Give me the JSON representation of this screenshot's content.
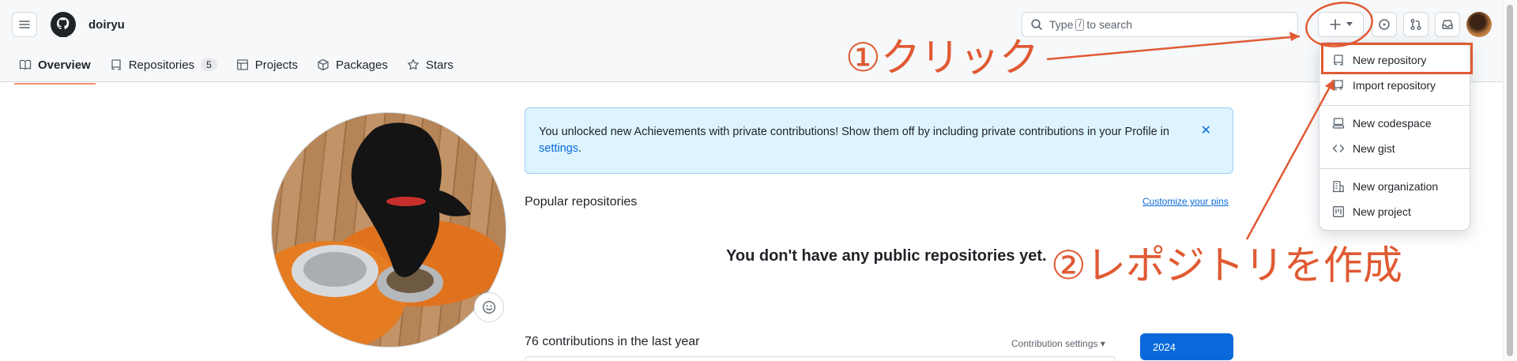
{
  "header": {
    "owner": "doiryu",
    "search": {
      "prefix": "Type",
      "key": "/",
      "suffix": "to search"
    },
    "icons": [
      "hamburger-icon",
      "github-logo-icon",
      "search-icon",
      "plus-icon",
      "caret-down-icon",
      "issue-icon",
      "pull-request-icon",
      "inbox-icon"
    ]
  },
  "tabs": [
    {
      "label": "Overview",
      "icon": "book-icon"
    },
    {
      "label": "Repositories",
      "icon": "repo-icon",
      "count": "5"
    },
    {
      "label": "Projects",
      "icon": "table-icon"
    },
    {
      "label": "Packages",
      "icon": "package-icon"
    },
    {
      "label": "Stars",
      "icon": "star-icon"
    }
  ],
  "banner": {
    "text": "You unlocked new Achievements with private contributions! Show them off by including private contributions in your Profile in",
    "link": "settings",
    "end": "."
  },
  "popular": {
    "title": "Popular repositories",
    "customize": "Customize your pins",
    "empty": "You don't have any public repositories yet."
  },
  "contributions": {
    "title": "76 contributions in the last year",
    "settings": "Contribution settings ▾",
    "year": "2024"
  },
  "menu": {
    "items": [
      {
        "label": "New repository",
        "icon": "repo-icon"
      },
      {
        "label": "Import repository",
        "icon": "repo-push-icon"
      },
      {
        "label": "New codespace",
        "icon": "codespaces-icon"
      },
      {
        "label": "New gist",
        "icon": "code-icon"
      },
      {
        "label": "New organization",
        "icon": "organization-icon"
      },
      {
        "label": "New project",
        "icon": "project-icon"
      }
    ]
  },
  "annotations": {
    "step1": "①クリック",
    "step2": "②レポジトリを作成"
  },
  "colors": {
    "annotation": "#e05a33",
    "link": "#0969da",
    "tab_underline": "#fd8c73",
    "banner_bg": "#ddf4ff"
  }
}
